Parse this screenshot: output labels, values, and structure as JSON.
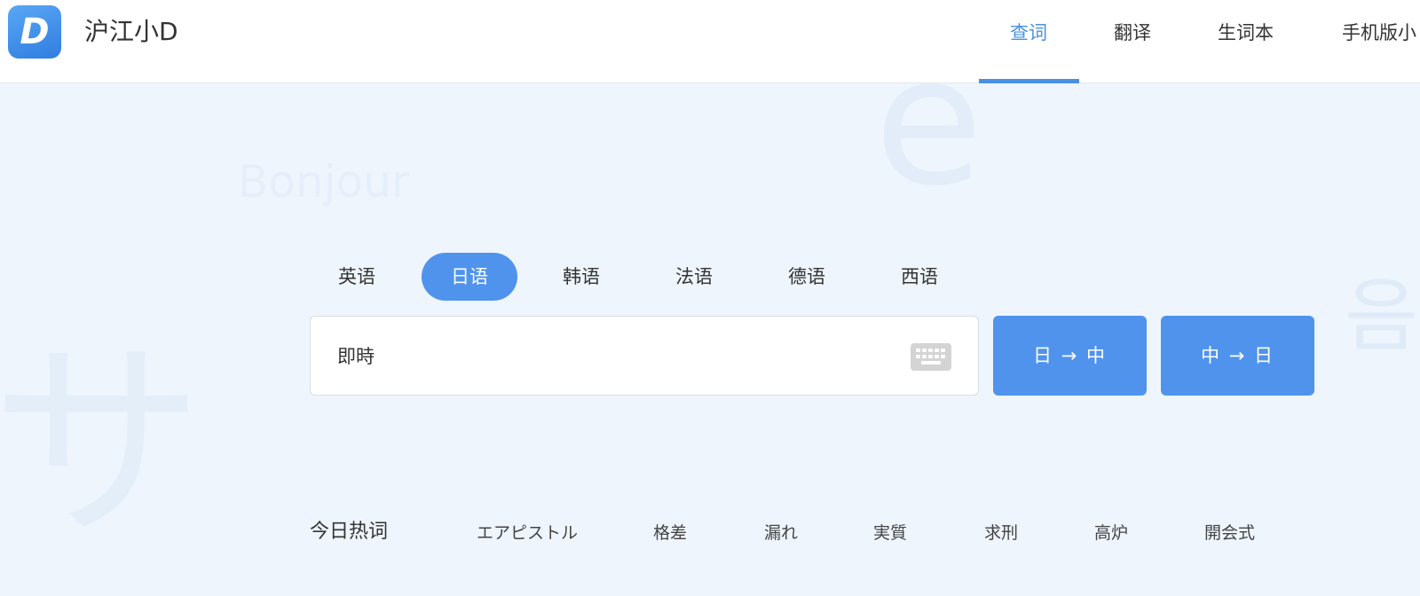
{
  "header": {
    "logo_letter": "D",
    "app_title": "沪江小D",
    "nav": [
      "查词",
      "翻译",
      "生词本",
      "手机版小"
    ]
  },
  "background": {
    "e": "e",
    "bonjour": "Bonjour",
    "sa": "サ",
    "eum": "음"
  },
  "languages": [
    "英语",
    "日语",
    "韩语",
    "法语",
    "德语",
    "西语"
  ],
  "active_language": "日语",
  "search": {
    "value": "即時",
    "placeholder": ""
  },
  "buttons": {
    "ja_to_zh": "日 → 中",
    "zh_to_ja": "中 → 日"
  },
  "hot": {
    "label": "今日热词",
    "words": [
      "エアピストル",
      "格差",
      "漏れ",
      "実質",
      "求刑",
      "高炉",
      "開会式"
    ]
  },
  "colors": {
    "accent": "#4f93ec",
    "nav_active": "#4a90e2",
    "page_bg": "#eef5fd"
  }
}
